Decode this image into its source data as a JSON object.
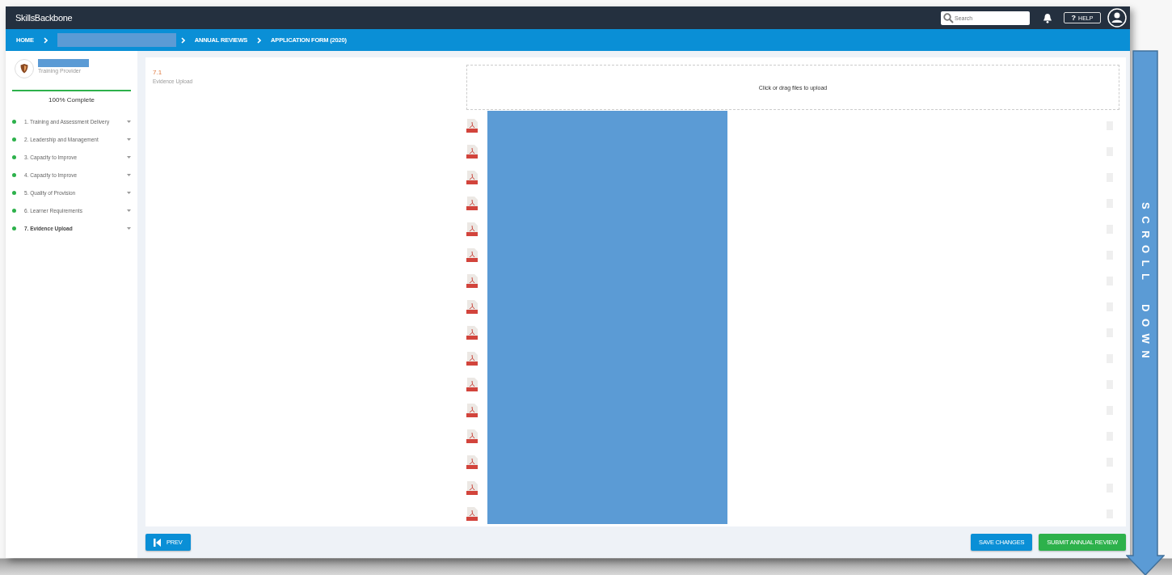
{
  "app": {
    "title": "SkillsBackbone"
  },
  "header": {
    "search": {
      "placeholder": "Search"
    },
    "help": {
      "icon": "?",
      "label": "HELP"
    }
  },
  "breadcrumbs": [
    {
      "kind": "link",
      "label": "HOME"
    },
    {
      "kind": "redacted"
    },
    {
      "kind": "link",
      "label": "ANNUAL REVIEWS"
    },
    {
      "kind": "link",
      "label": "APPLICATION FORM (2020)"
    }
  ],
  "provider": {
    "name": {
      "kind": "redacted"
    },
    "role": "Training Provider"
  },
  "progress": {
    "level": 1.0,
    "label": "100% Complete"
  },
  "sections": [
    {
      "label": "1. Training and Assessment Delivery",
      "complete": true,
      "selected": false
    },
    {
      "label": "2. Leadership and Management",
      "complete": true,
      "selected": false
    },
    {
      "label": "3. Capacity to Improve",
      "complete": true,
      "selected": false
    },
    {
      "label": "4. Capacity to Improve",
      "complete": true,
      "selected": false
    },
    {
      "label": "5. Quality of Provision",
      "complete": true,
      "selected": false
    },
    {
      "label": "6. Learner Requirements",
      "complete": true,
      "selected": false
    },
    {
      "label": "7. Evidence Upload",
      "complete": true,
      "selected": true
    }
  ],
  "question": {
    "number": "7.1",
    "title": "Evidence Upload"
  },
  "upload": {
    "prompt": "Click or drag files to upload"
  },
  "files": [
    {
      "kind": "pdf"
    },
    {
      "kind": "pdf"
    },
    {
      "kind": "pdf"
    },
    {
      "kind": "pdf"
    },
    {
      "kind": "pdf"
    },
    {
      "kind": "pdf"
    },
    {
      "kind": "pdf"
    },
    {
      "kind": "pdf"
    },
    {
      "kind": "pdf"
    },
    {
      "kind": "pdf"
    },
    {
      "kind": "pdf"
    },
    {
      "kind": "pdf"
    },
    {
      "kind": "pdf"
    },
    {
      "kind": "pdf"
    },
    {
      "kind": "pdf"
    },
    {
      "kind": "pdf"
    }
  ],
  "files_redacted": true,
  "footer": {
    "prev": "PREV",
    "save": "SAVE CHANGES",
    "submit": "SUBMIT ANNUAL REVIEW"
  },
  "annotation": {
    "words": [
      "SCROLL",
      "DOWN"
    ]
  }
}
